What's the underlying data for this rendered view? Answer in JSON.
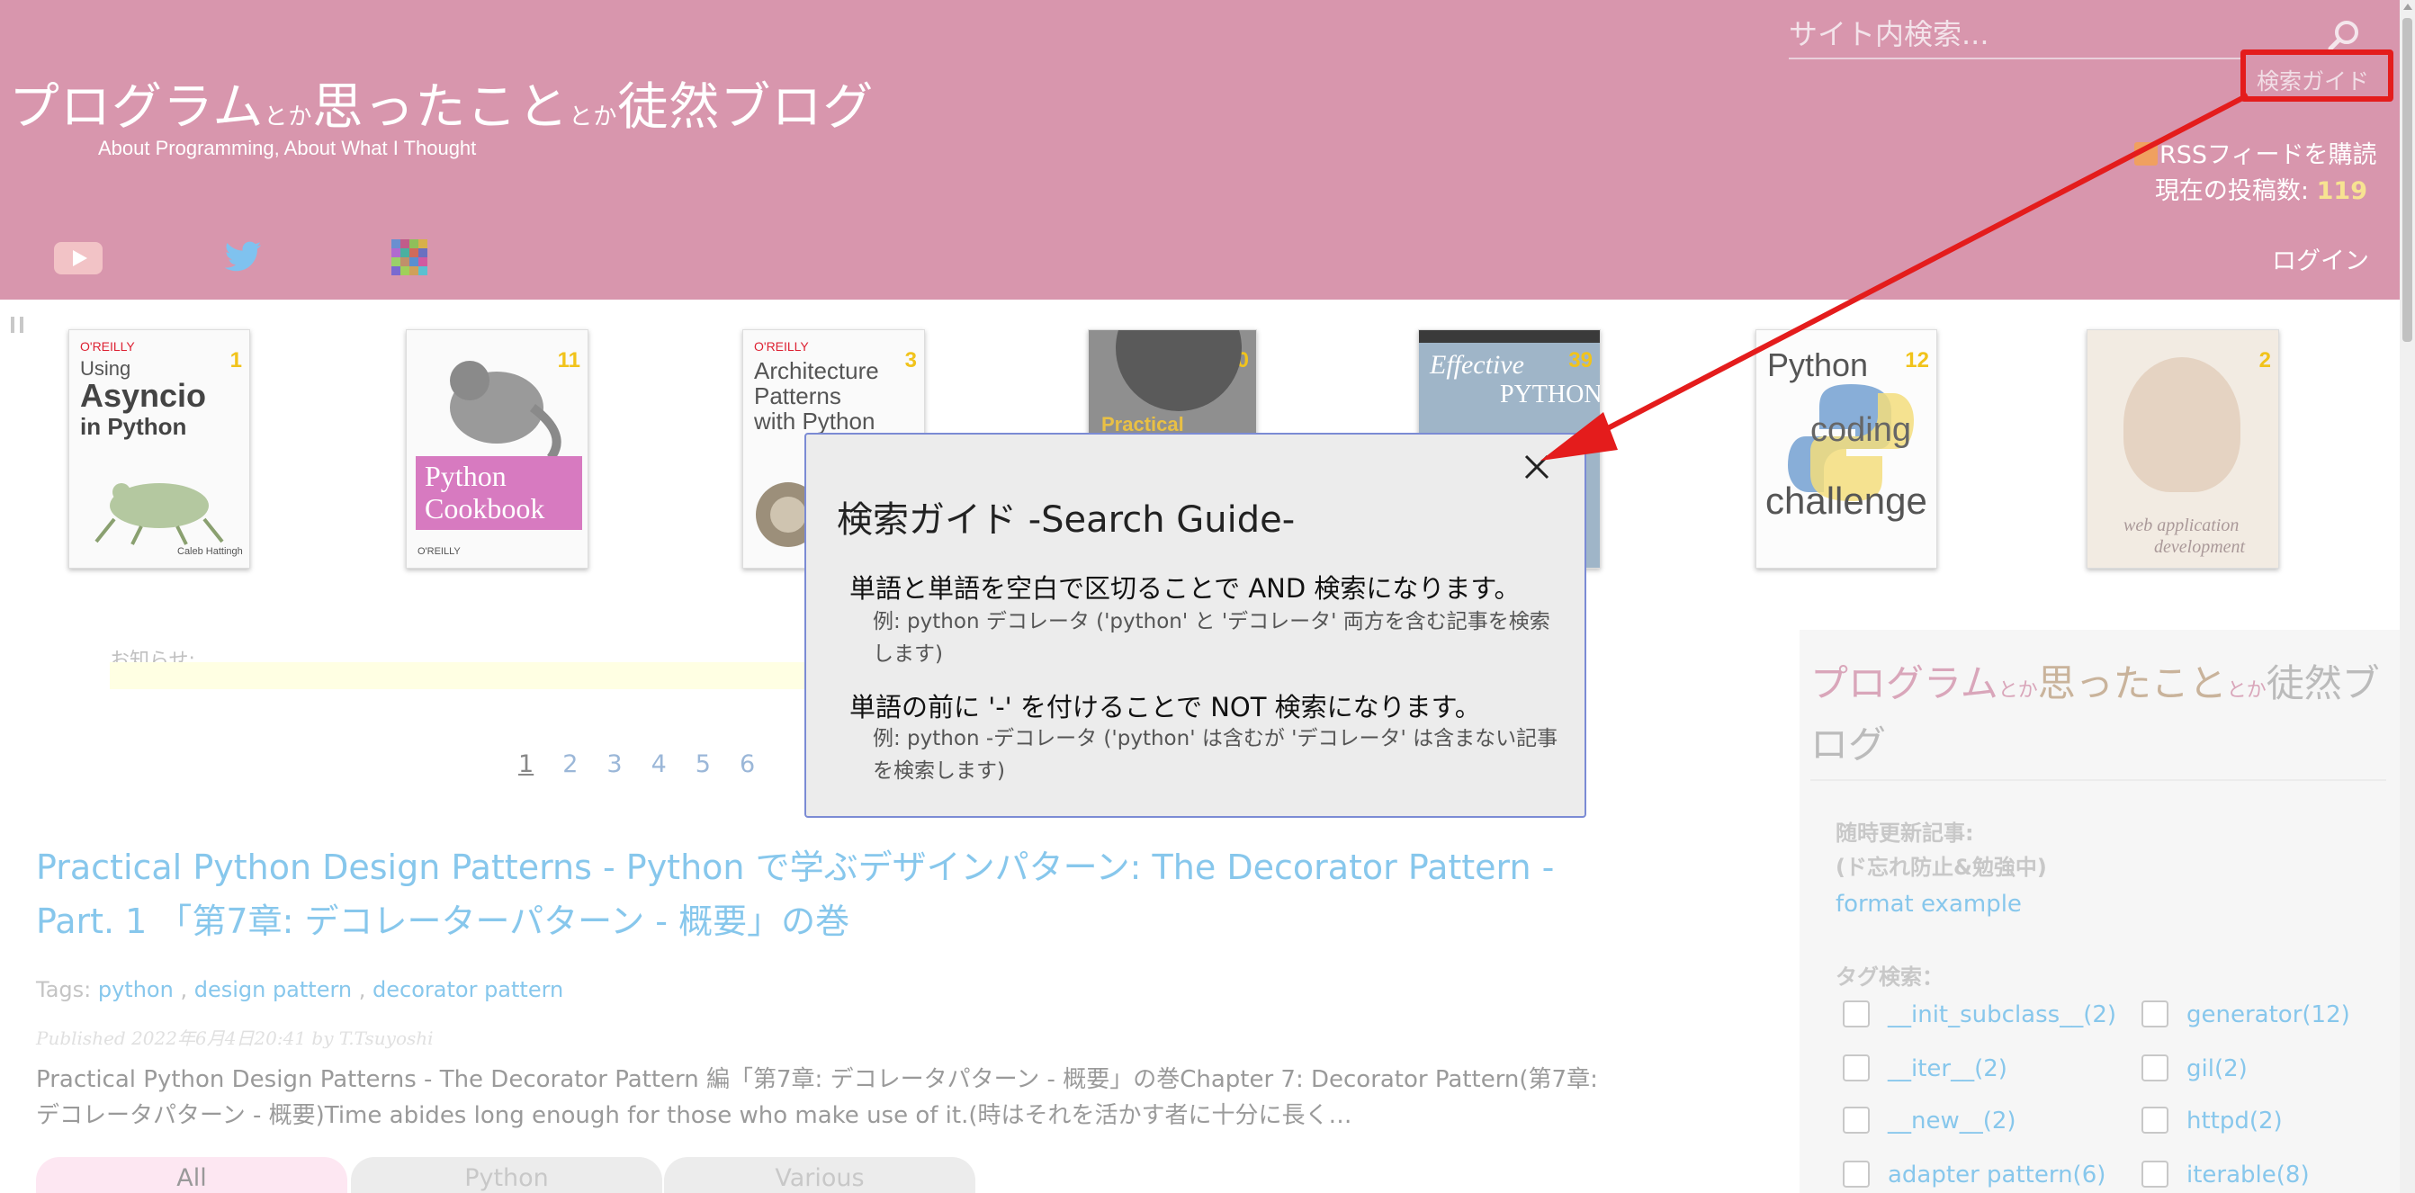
{
  "header": {
    "title_main1": "プログラム",
    "title_small1": "とか",
    "title_main2": "思ったこと",
    "title_small2": "とか",
    "title_main3": "徒然ブログ",
    "subtitle": "About Programming, About What I Thought",
    "search_placeholder": "サイト内検索...",
    "search_guide_label": "検索ガイド",
    "rss_label": "RSSフィードを購読",
    "post_count_label": "現在の投稿数: ",
    "post_count_value": "119",
    "login_label": "ログイン",
    "social_icons": [
      "youtube-icon",
      "twitter-icon",
      "mosaic-icon"
    ]
  },
  "books": [
    {
      "rank": "1",
      "title_lines": [
        "O'REILLY",
        "Using",
        "Asyncio",
        "in Python"
      ],
      "author": "Caleb Hattingh"
    },
    {
      "rank": "11",
      "title_lines": [
        "Python",
        "Cookbook"
      ],
      "author": "O'REILLY"
    },
    {
      "rank": "3",
      "title_lines": [
        "O'REILLY",
        "Architecture",
        "Patterns",
        "with Python"
      ]
    },
    {
      "rank": "20",
      "title_lines": [
        "Practical Python"
      ]
    },
    {
      "rank": "39",
      "title_lines": [
        "Effective",
        "PYTHON"
      ]
    },
    {
      "rank": "12",
      "title_lines": [
        "Python",
        "coding",
        "challenge"
      ]
    },
    {
      "rank": "2",
      "title_lines": [
        "web application",
        "development"
      ]
    }
  ],
  "notice_label": "お知らせ:",
  "pager": [
    "1",
    "2",
    "3",
    "4",
    "5",
    "6"
  ],
  "post": {
    "title": "Practical Python Design Patterns - Python で学ぶデザインパターン: The Decorator Pattern - Part. 1 「第7章: デコレーターパターン - 概要」の巻",
    "tags_label": "Tags:",
    "tags": [
      "python",
      "design pattern",
      "decorator pattern"
    ],
    "published": "Published 2022年6月4日20:41 by T.Tsuyoshi",
    "excerpt": "Practical Python Design Patterns - The Decorator Pattern 編「第7章: デコレータパターン - 概要」の巻Chapter 7: Decorator Pattern(第7章: デコレータパターン - 概要)Time abides long enough for those who make use of it.(時はそれを活かす者に十分に長く…"
  },
  "category_tabs": [
    "All",
    "Python",
    "Various"
  ],
  "sidebar": {
    "title_main1": "プログラム",
    "title_small1": "とか",
    "title_main2": "思ったこと",
    "title_small2": "とか",
    "title_main3": "徒然ブログ",
    "updated_heading_1": "随時更新記事:",
    "updated_heading_2": "(ド忘れ防止&勉強中)",
    "updated_link": "format example",
    "tag_search_label": "タグ検索：",
    "tags_left": [
      "__init_subclass__(2)",
      "__iter__(2)",
      "__new__(2)",
      "adapter pattern(6)"
    ],
    "tags_right": [
      "generator(12)",
      "gil(2)",
      "httpd(2)",
      "iterable(8)"
    ]
  },
  "modal": {
    "title": "検索ガイド -Search Guide-",
    "rule1": "単語と単語を空白で区切ることで AND 検索になります。",
    "example1": "例: python デコレータ ('python' と 'デコレータ' 両方を含む記事を検索します)",
    "rule2": "単語の前に '-' を付けることで NOT 検索になります。",
    "example2": "例: python -デコレータ ('python' は含むが 'デコレータ' は含まない記事を検索します)"
  },
  "colors": {
    "header_bg": "#d896ad",
    "accent_link": "#87c7ec",
    "annotation_red": "#e41c1c",
    "count_yellow": "#f7e391"
  }
}
